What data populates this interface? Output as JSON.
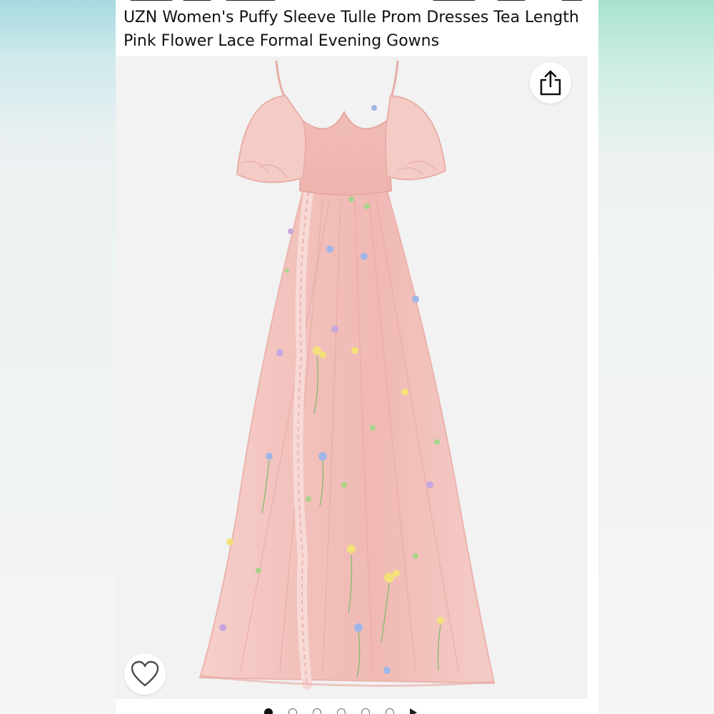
{
  "product": {
    "title": "UZN Women's Puffy Sleeve Tulle Prom Dresses Tea Length Pink Flower Lace Formal Evening Gowns"
  },
  "image": {
    "subject": "pink floral embroidered tulle gown"
  },
  "actions": {
    "share_icon": "share-icon",
    "favorite_icon": "heart-icon"
  },
  "carousel": {
    "total_dots": 6,
    "active_index": 0,
    "has_video_indicator": true
  },
  "colors": {
    "dress_pink": "#f3c3bf",
    "background": "#f2f2f2",
    "panel": "#ffffff"
  }
}
